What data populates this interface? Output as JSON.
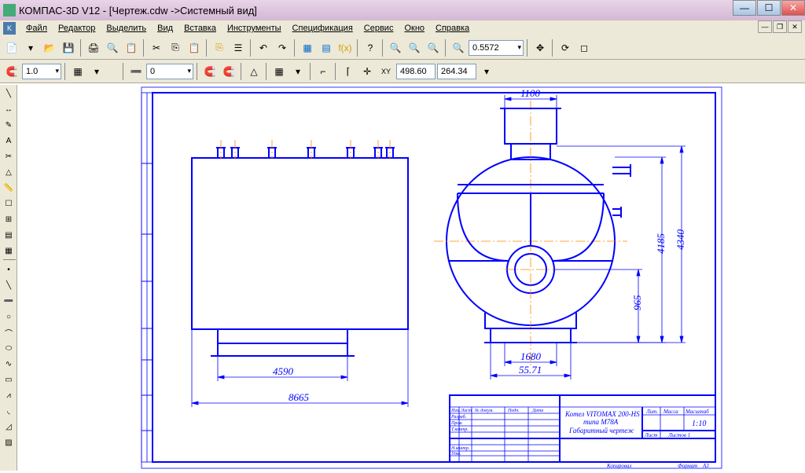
{
  "app": {
    "title": "КОМПАС-3D V12 - [Чертеж.cdw ->Системный вид]"
  },
  "menu": {
    "file": "Файл",
    "editor": "Редактор",
    "select": "Выделить",
    "view": "Вид",
    "insert": "Вставка",
    "tools": "Инструменты",
    "spec": "Спецификация",
    "service": "Сервис",
    "window": "Окно",
    "help": "Справка"
  },
  "toolbar1": {
    "zoom_value": "0.5572"
  },
  "toolbar2": {
    "step": "1.0",
    "style": "0",
    "coord_x": "498.60",
    "coord_y": "264.34"
  },
  "drawing": {
    "dims": {
      "d_1100": "1100",
      "d_4590": "4590",
      "d_8665": "8665",
      "d_1680": "1680",
      "d_5571": "55.71",
      "d_965": "965",
      "d_4185": "4185",
      "d_4340": "4340"
    },
    "titleblock": {
      "line1": "Котел VITOMAX 200-HS",
      "line2": "типа M78A",
      "line3": "Габаритный чертеж",
      "col_izm": "Изм.",
      "col_list": "Лист",
      "col_ndoc": "№ докум.",
      "col_podp": "Подп.",
      "col_data": "Дата",
      "row_razrab": "Разраб.",
      "row_prov": "Пров.",
      "row_tkontr": "Т.контр.",
      "row_nkontr": "Н.контр.",
      "row_utv": "Утв.",
      "lit": "Лит.",
      "massa": "Масса",
      "masshtab": "Масштаб",
      "scale": "1:10",
      "list": "Лист",
      "listov": "Листов 1",
      "kopiroval": "Копировал",
      "format": "Формат",
      "a3": "A3"
    }
  }
}
